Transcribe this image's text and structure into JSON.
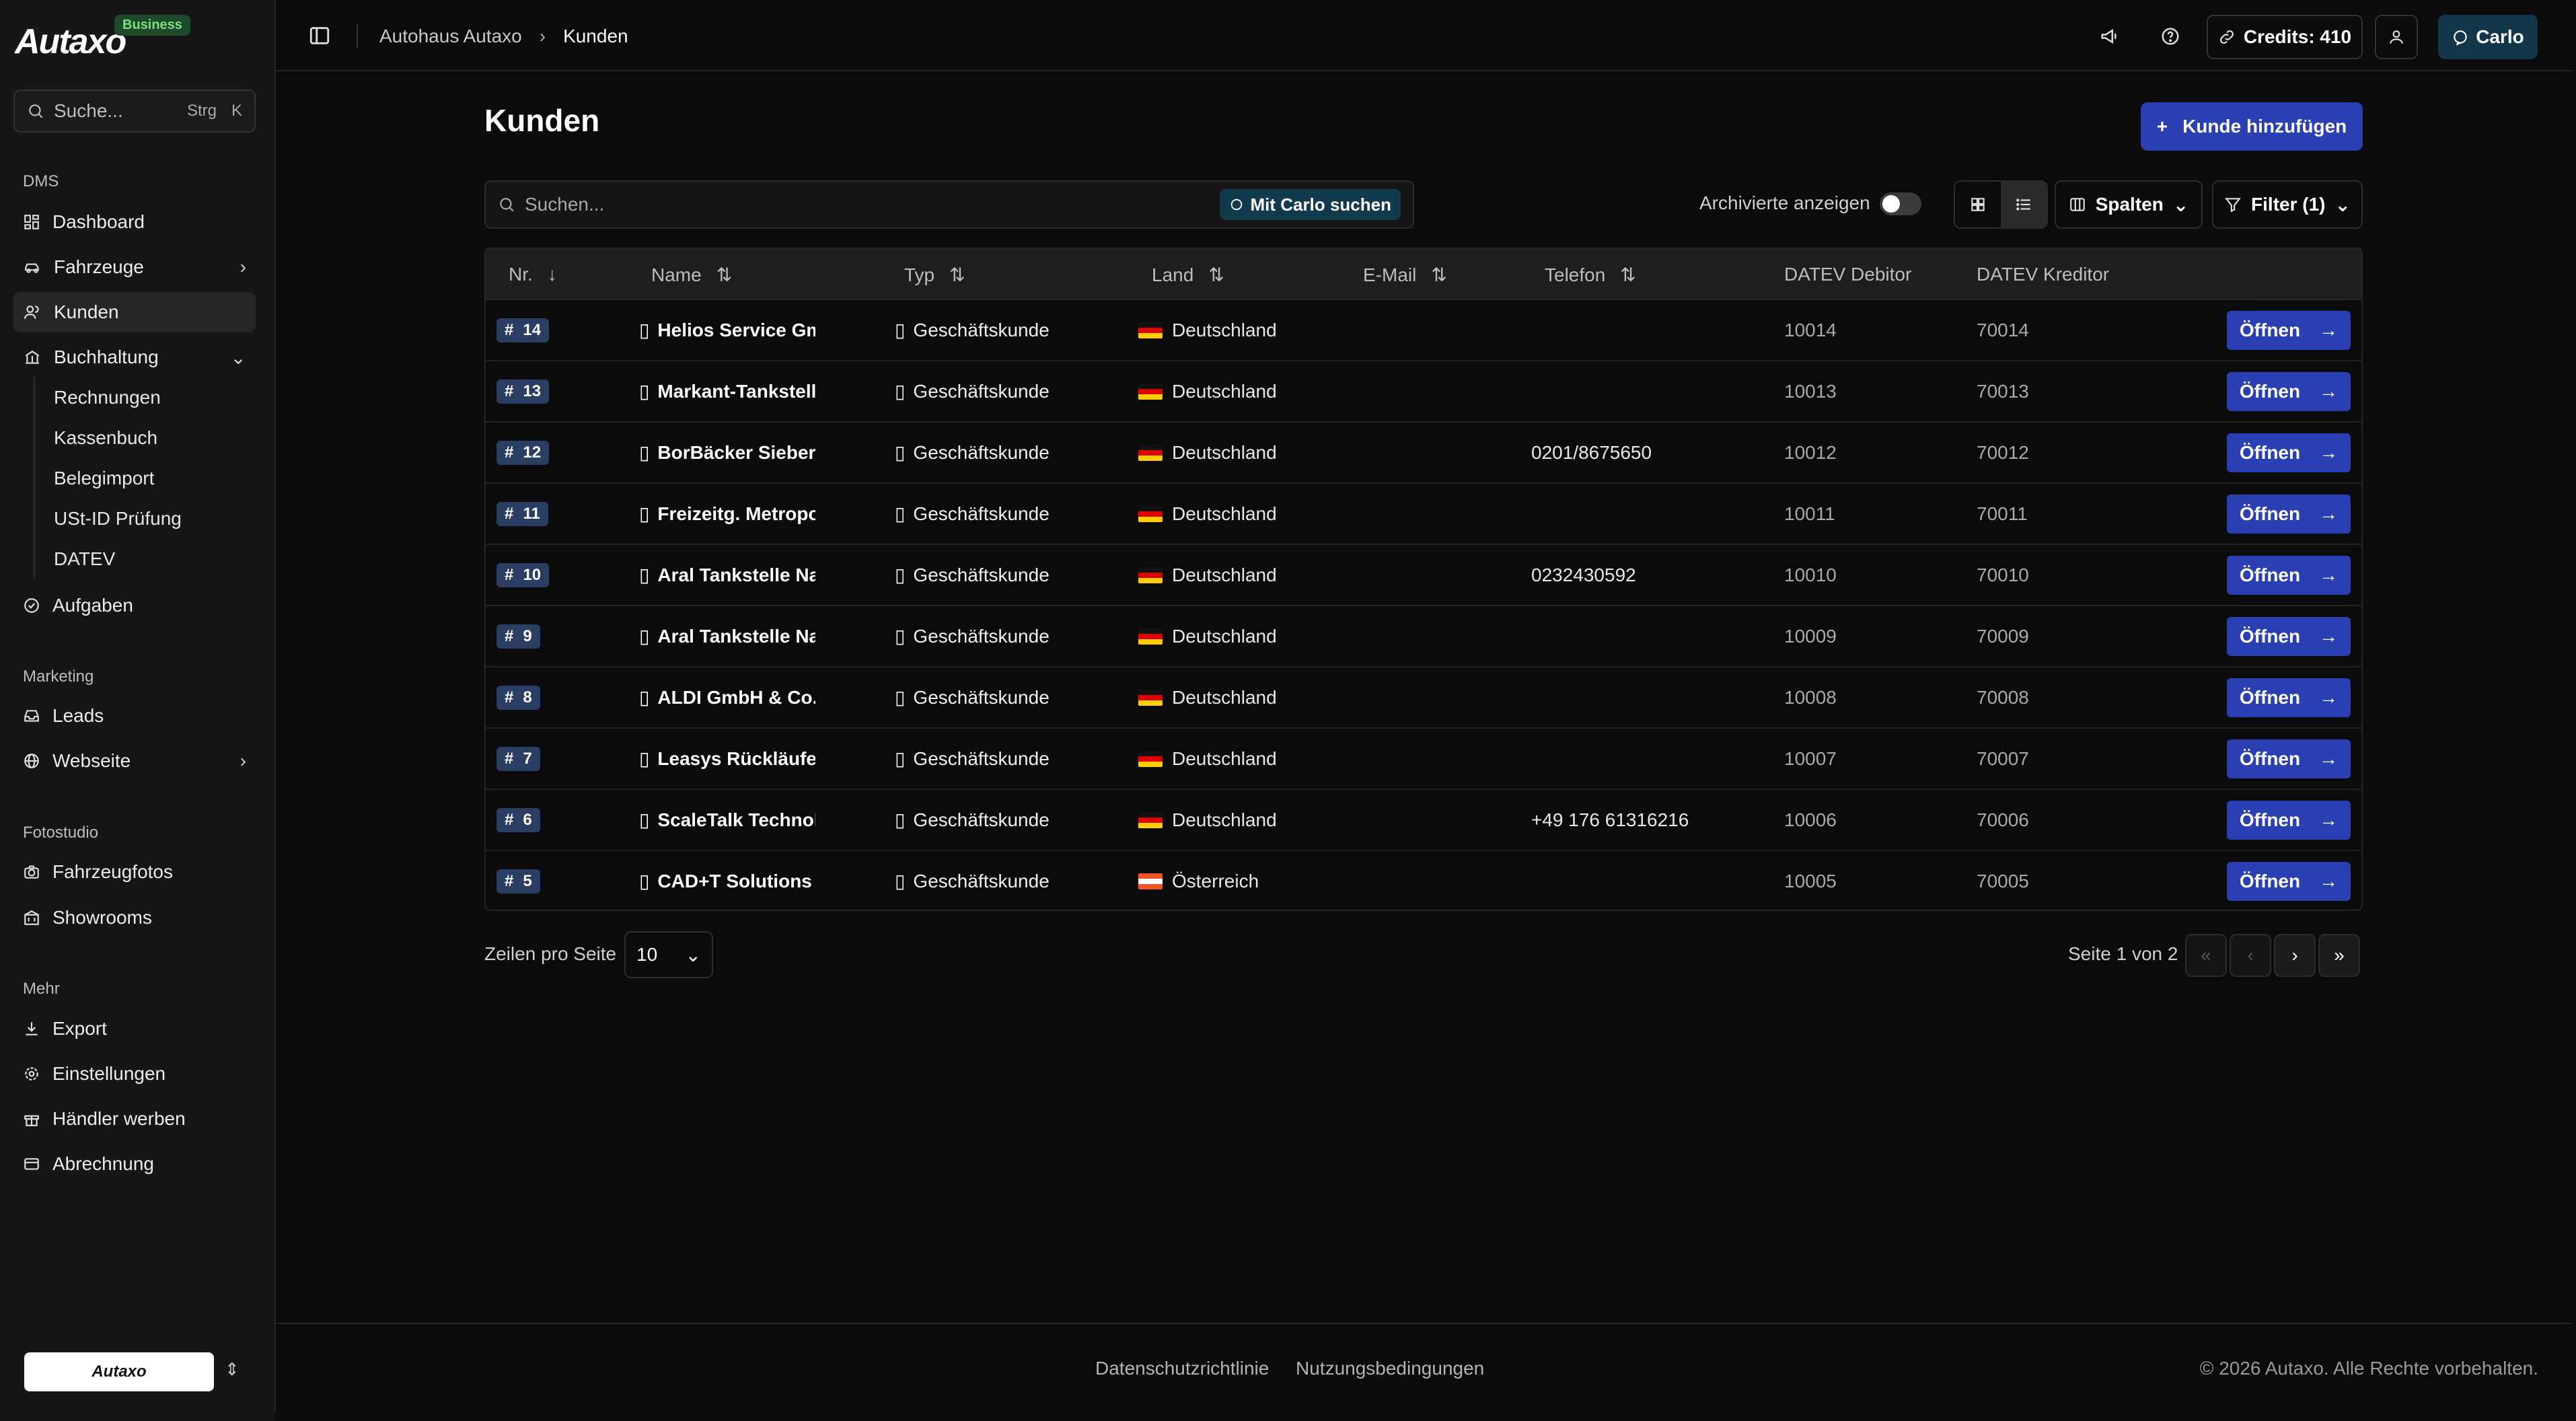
{
  "brand": {
    "name": "Autaxo",
    "badge": "Business"
  },
  "sidebar": {
    "search_placeholder": "Suche...",
    "search_shortcut_mod": "Strg",
    "search_shortcut_key": "K",
    "sections": {
      "dms": "DMS",
      "marketing": "Marketing",
      "fotostudio": "Fotostudio",
      "mehr": "Mehr"
    },
    "items": {
      "dashboard": "Dashboard",
      "fahrzeuge": "Fahrzeuge",
      "kunden": "Kunden",
      "buchhaltung": "Buchhaltung",
      "rechnungen": "Rechnungen",
      "kassenbuch": "Kassenbuch",
      "belegimport": "Belegimport",
      "ustid": "USt-ID Prüfung",
      "datev": "DATEV",
      "aufgaben": "Aufgaben",
      "leads": "Leads",
      "webseite": "Webseite",
      "fahrzeugfotos": "Fahrzeugfotos",
      "showrooms": "Showrooms",
      "export": "Export",
      "einstellungen": "Einstellungen",
      "haendler": "Händler werben",
      "abrechnung": "Abrechnung"
    },
    "org_logo": "Autaxo"
  },
  "topbar": {
    "crumb_1": "Autohaus Autaxo",
    "crumb_2": "Kunden",
    "credits": "Credits: 410",
    "user": "Carlo"
  },
  "page": {
    "title": "Kunden",
    "add_button": "Kunde hinzufügen",
    "search_placeholder": "Suchen...",
    "carlo_search": "Mit Carlo suchen",
    "archived_label": "Archivierte anzeigen",
    "columns_button": "Spalten",
    "filter_button": "Filter (1)"
  },
  "table": {
    "headers": {
      "nr": "Nr.",
      "name": "Name",
      "typ": "Typ",
      "land": "Land",
      "email": "E-Mail",
      "telefon": "Telefon",
      "debitor": "DATEV Debitor",
      "kreditor": "DATEV Kreditor"
    },
    "open_label": "Öffnen",
    "rows": [
      {
        "nr": "14",
        "name": "Helios Service Gm",
        "typ": "Geschäftskunde",
        "land": "Deutschland",
        "telefon": "",
        "debitor": "10014",
        "kreditor": "70014"
      },
      {
        "nr": "13",
        "name": "Markant-Tankstell",
        "typ": "Geschäftskunde",
        "land": "Deutschland",
        "telefon": "",
        "debitor": "10013",
        "kreditor": "70013"
      },
      {
        "nr": "12",
        "name": "BorBäcker Siebers",
        "typ": "Geschäftskunde",
        "land": "Deutschland",
        "telefon": "0201/8675650",
        "debitor": "10012",
        "kreditor": "70012"
      },
      {
        "nr": "11",
        "name": "Freizeitg. Metropo",
        "typ": "Geschäftskunde",
        "land": "Deutschland",
        "telefon": "",
        "debitor": "10011",
        "kreditor": "70011"
      },
      {
        "nr": "10",
        "name": "Aral Tankstelle Na",
        "typ": "Geschäftskunde",
        "land": "Deutschland",
        "telefon": "0232430592",
        "debitor": "10010",
        "kreditor": "70010"
      },
      {
        "nr": "9",
        "name": "Aral Tankstelle Na",
        "typ": "Geschäftskunde",
        "land": "Deutschland",
        "telefon": "",
        "debitor": "10009",
        "kreditor": "70009"
      },
      {
        "nr": "8",
        "name": "ALDI GmbH & Co.",
        "typ": "Geschäftskunde",
        "land": "Deutschland",
        "telefon": "",
        "debitor": "10008",
        "kreditor": "70008"
      },
      {
        "nr": "7",
        "name": "Leasys Rückläufe",
        "typ": "Geschäftskunde",
        "land": "Deutschland",
        "telefon": "",
        "debitor": "10007",
        "kreditor": "70007"
      },
      {
        "nr": "6",
        "name": "ScaleTalk Technol",
        "typ": "Geschäftskunde",
        "land": "Deutschland",
        "telefon": "+49 176 61316216",
        "debitor": "10006",
        "kreditor": "70006"
      },
      {
        "nr": "5",
        "name": "CAD+T Solutions",
        "typ": "Geschäftskunde",
        "land": "Österreich",
        "telefon": "",
        "debitor": "10005",
        "kreditor": "70005"
      }
    ]
  },
  "pagination": {
    "rows_label": "Zeilen pro Seite",
    "rows_value": "10",
    "page_info": "Seite 1 von 2"
  },
  "footer": {
    "privacy": "Datenschutzrichtlinie",
    "terms": "Nutzungsbedingungen",
    "copyright": "© 2026 Autaxo. Alle Rechte vorbehalten."
  }
}
